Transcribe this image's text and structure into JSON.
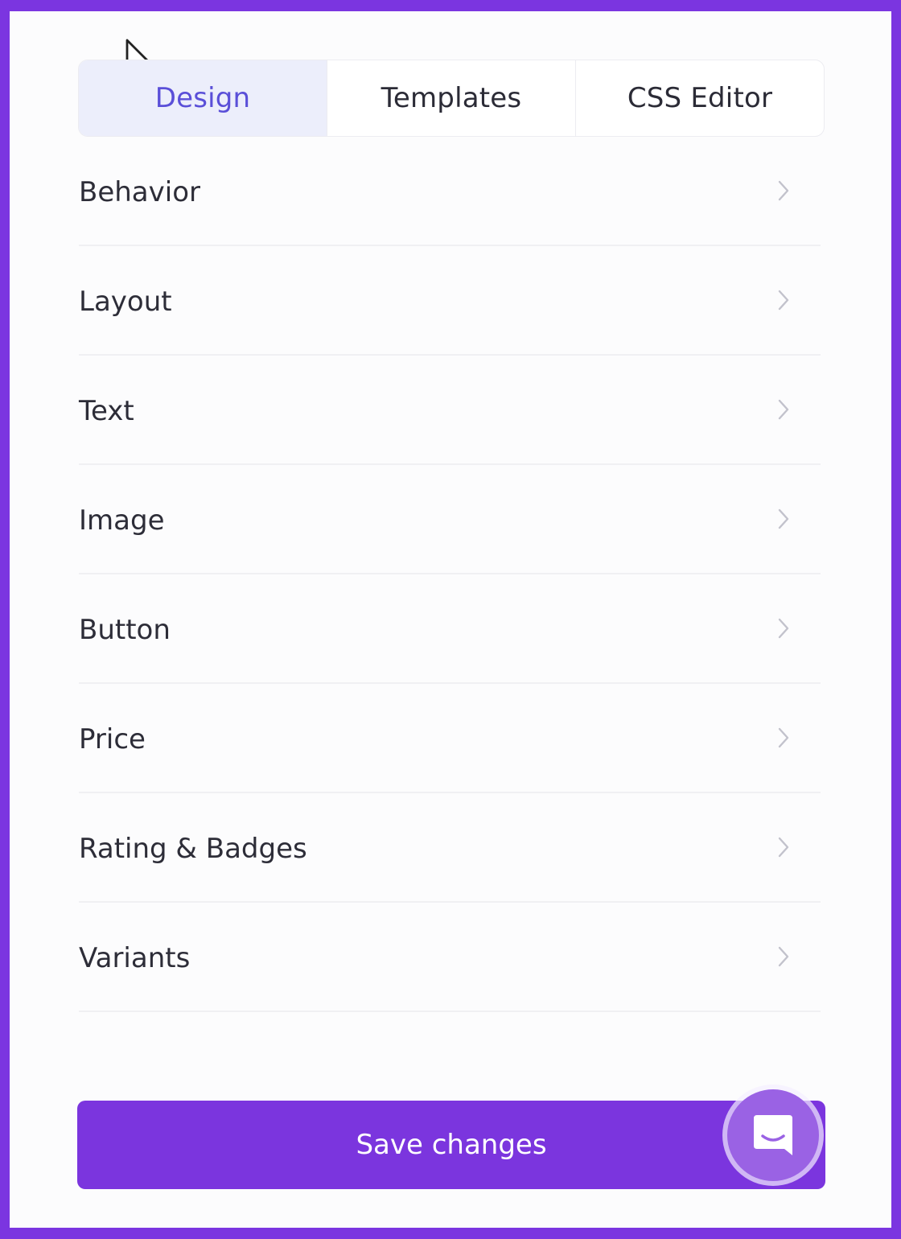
{
  "tabs": [
    {
      "label": "Design",
      "active": true
    },
    {
      "label": "Templates",
      "active": false
    },
    {
      "label": "CSS Editor",
      "active": false
    }
  ],
  "menu": {
    "items": [
      {
        "label": "Behavior",
        "icon": "chevron-right-icon"
      },
      {
        "label": "Layout",
        "icon": "chevron-right-icon"
      },
      {
        "label": "Text",
        "icon": "chevron-right-icon"
      },
      {
        "label": "Image",
        "icon": "chevron-right-icon"
      },
      {
        "label": "Button",
        "icon": "chevron-right-icon"
      },
      {
        "label": "Price",
        "icon": "chevron-right-icon"
      },
      {
        "label": "Rating & Badges",
        "icon": "chevron-right-icon"
      },
      {
        "label": "Variants",
        "icon": "chevron-right-icon"
      }
    ]
  },
  "footer": {
    "save_label": "Save changes",
    "chat_icon": "chat-bubble-icon"
  },
  "colors": {
    "frame": "#7b35e0",
    "accent": "#7b35de",
    "active_tab_bg": "#eceefb",
    "active_tab_text": "#5a4fd8"
  }
}
